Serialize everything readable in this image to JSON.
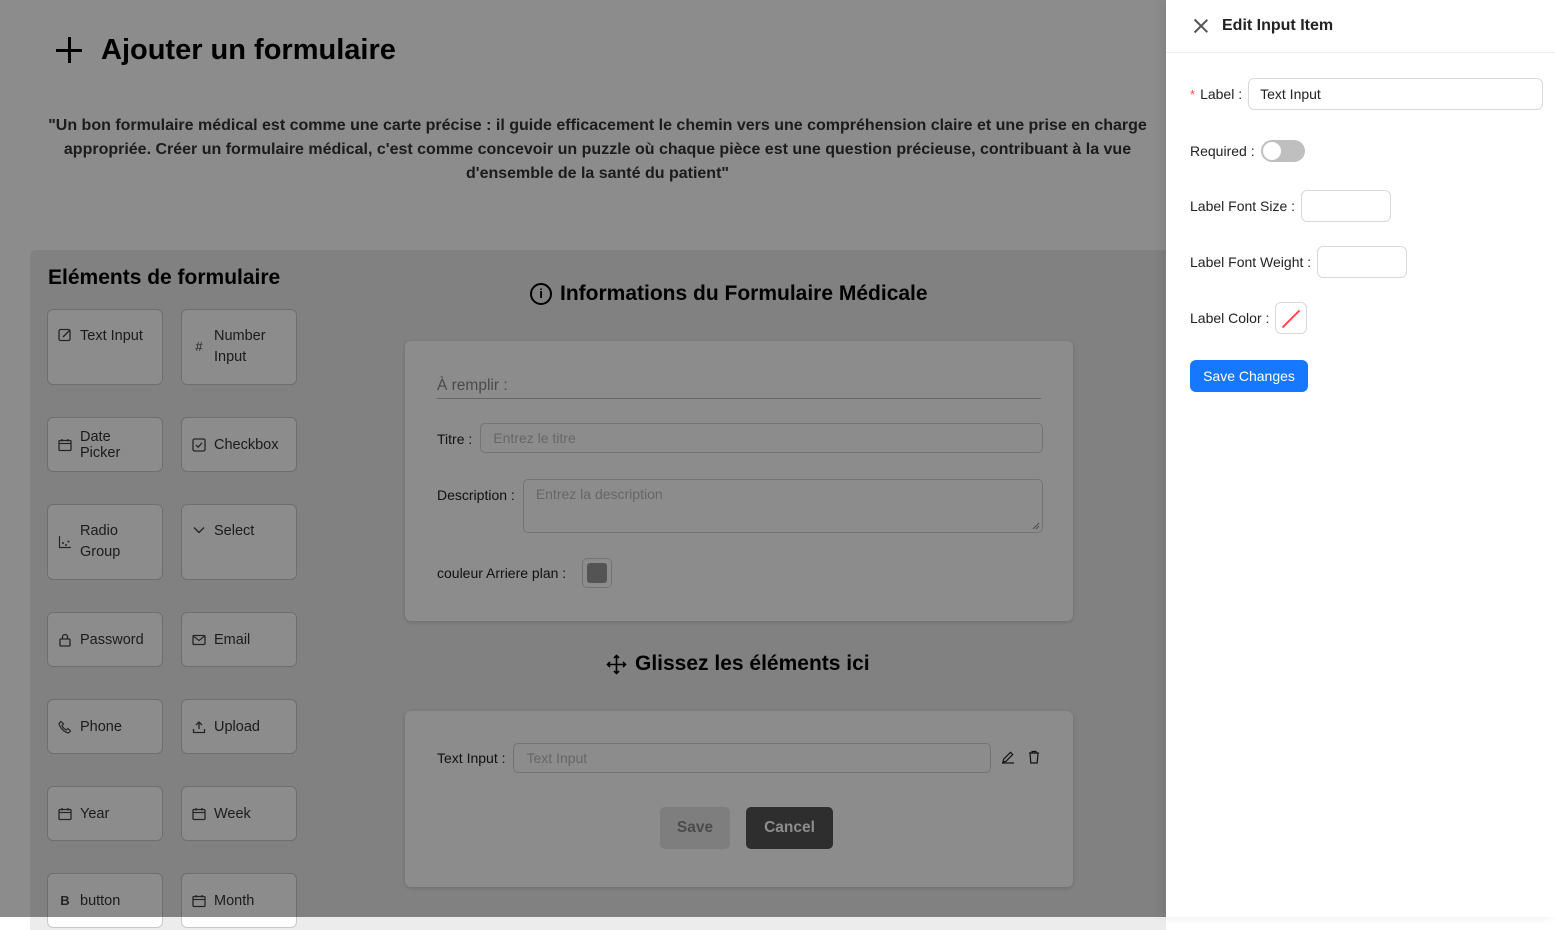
{
  "page": {
    "title": "Ajouter un formulaire",
    "quote": "\"Un bon formulaire médical est comme une carte précise : il guide efficacement le chemin vers une compréhension claire et une prise en charge appropriée. Créer un formulaire médical, c'est comme concevoir un puzzle où chaque pièce est une question précieuse, contribuant à la vue d'ensemble de la santé du patient\""
  },
  "sidebar": {
    "title": "Eléments de formulaire",
    "items": [
      {
        "label": "Text Input",
        "icon": "edit-icon"
      },
      {
        "label": "Number Input",
        "icon": "hash-icon"
      },
      {
        "label": "Date Picker",
        "icon": "calendar-icon"
      },
      {
        "label": "Checkbox",
        "icon": "checkbox-icon"
      },
      {
        "label": "Radio Group",
        "icon": "chart-icon"
      },
      {
        "label": "Select",
        "icon": "chevron-down-icon"
      },
      {
        "label": "Password",
        "icon": "lock-icon"
      },
      {
        "label": "Email",
        "icon": "mail-icon"
      },
      {
        "label": "Phone",
        "icon": "phone-icon"
      },
      {
        "label": "Upload",
        "icon": "upload-icon"
      },
      {
        "label": "Year",
        "icon": "calendar-icon"
      },
      {
        "label": "Week",
        "icon": "calendar-icon"
      },
      {
        "label": "button",
        "icon": "bold-icon"
      },
      {
        "label": "Month",
        "icon": "calendar-icon"
      }
    ]
  },
  "info_section": {
    "title": "Informations du Formulaire Médicale",
    "fill_label": "À remplir :",
    "title_label": "Titre",
    "title_placeholder": "Entrez le titre",
    "description_label": "Description",
    "description_placeholder": "Entrez la description",
    "bg_color_label": "couleur Arriere plan :",
    "bg_color": "#9a9a9a"
  },
  "drop_section": {
    "title": "Glissez les éléments ici",
    "text_input_label": "Text Input",
    "text_input_placeholder": "Text Input",
    "save_label": "Save",
    "cancel_label": "Cancel"
  },
  "drawer": {
    "title": "Edit Input Item",
    "label_label": "Label",
    "label_value": "Text Input",
    "required_label": "Required",
    "required_on": false,
    "font_size_label": "Label Font Size",
    "font_weight_label": "Label Font Weight",
    "color_label": "Label Color",
    "save_label": "Save Changes"
  },
  "colors": {
    "primary": "#1677ff",
    "required_mark": "#ff4d4f",
    "overlay": "rgba(0,0,0,0.45)"
  }
}
